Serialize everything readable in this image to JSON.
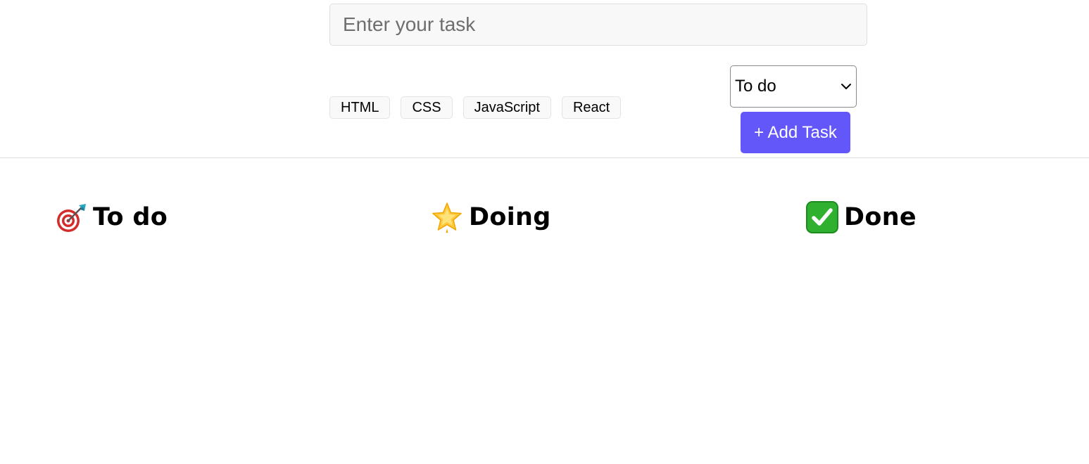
{
  "form": {
    "task_input": {
      "placeholder": "Enter your task",
      "value": ""
    },
    "tags": [
      {
        "label": "HTML"
      },
      {
        "label": "CSS"
      },
      {
        "label": "JavaScript"
      },
      {
        "label": "React"
      }
    ],
    "status_select": {
      "selected": "To do",
      "icon": "chevron-down-icon"
    },
    "add_button": {
      "label": "+ Add Task",
      "color": "#6457f9"
    }
  },
  "columns": [
    {
      "title": "To do",
      "icon": "target-dart-icon"
    },
    {
      "title": "Doing",
      "icon": "glowing-star-icon"
    },
    {
      "title": "Done",
      "icon": "check-mark-button-icon",
      "icon_color": "#2fb12f"
    }
  ],
  "colors": {
    "accent": "#6457f9",
    "divider": "#dcdcdc"
  }
}
